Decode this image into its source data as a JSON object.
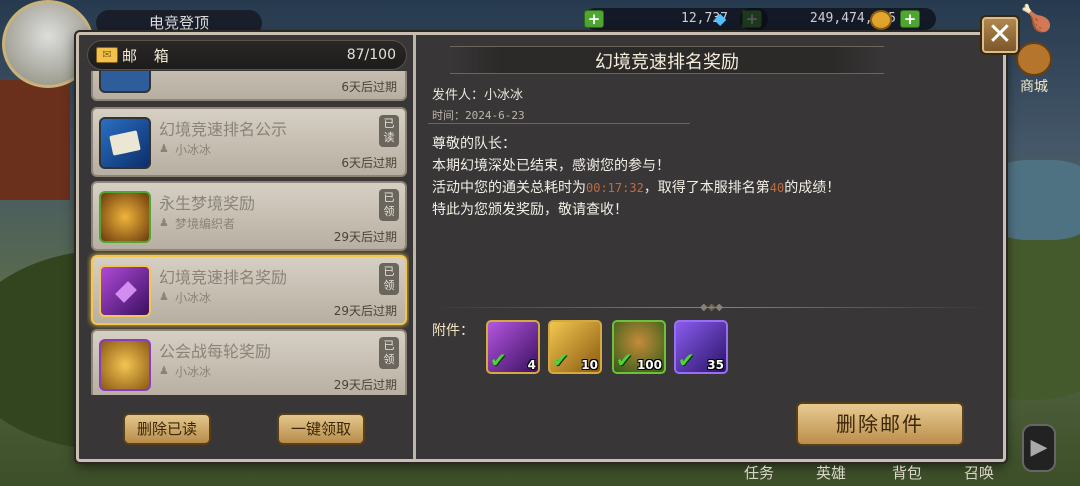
{
  "hud": {
    "name_label": "电竞登顶",
    "gems": "12,737",
    "gold": "249,474,605",
    "plus": "+",
    "shop_label": "商城",
    "close_glyph": "✕"
  },
  "mailbox": {
    "title": "邮 箱",
    "count": "87/100",
    "items": [
      {
        "title": "",
        "sender": "",
        "expire": "6天后过期",
        "tag": ""
      },
      {
        "title": "幻境竞速排名公示",
        "sender": "小冰冰",
        "expire": "6天后过期",
        "tag": "已读",
        "icon": "envelope-icon"
      },
      {
        "title": "永生梦境奖励",
        "sender": "梦境编织者",
        "expire": "29天后过期",
        "tag": "已领",
        "icon": "gold-pile-icon"
      },
      {
        "title": "幻境竞速排名奖励",
        "sender": "小冰冰",
        "expire": "29天后过期",
        "tag": "已领",
        "icon": "purple-card-icon",
        "selected": true
      },
      {
        "title": "公会战每轮奖励",
        "sender": "小冰冰",
        "expire": "29天后过期",
        "tag": "已领",
        "icon": "guild-coin-icon"
      }
    ],
    "delete_read_label": "删除已读",
    "claim_all_label": "一键领取"
  },
  "detail": {
    "title": "幻境竞速排名奖励",
    "sender_label": "发件人：",
    "sender": "小冰冰",
    "time_label": "时间：",
    "time": "2024-6-23",
    "body": {
      "line1": "尊敬的队长：",
      "line2": "本期幻境深处已结束，感谢您的参与！",
      "line3_pre": "活动中您的通关总耗时为",
      "time_value": "00:17:32",
      "line3_mid": "，取得了本服排名第",
      "rank_value": "40",
      "line3_post": "的成绩！",
      "line4": "特此为您颁发奖励，敬请查收！"
    },
    "attachments_label": "附件：",
    "attachments": [
      {
        "count": "4",
        "icon": "purple-card-icon",
        "color": "#7a2fa8"
      },
      {
        "count": "10",
        "icon": "gold-card-icon",
        "color": "#c8901c"
      },
      {
        "count": "100",
        "icon": "treasure-chest-icon",
        "color": "#4a8a2a"
      },
      {
        "count": "35",
        "icon": "purple-cube-icon",
        "color": "#4b2aa0"
      }
    ],
    "delete_label": "删除邮件"
  },
  "bottom_nav": [
    "任务",
    "英雄",
    "背包",
    "召唤"
  ]
}
